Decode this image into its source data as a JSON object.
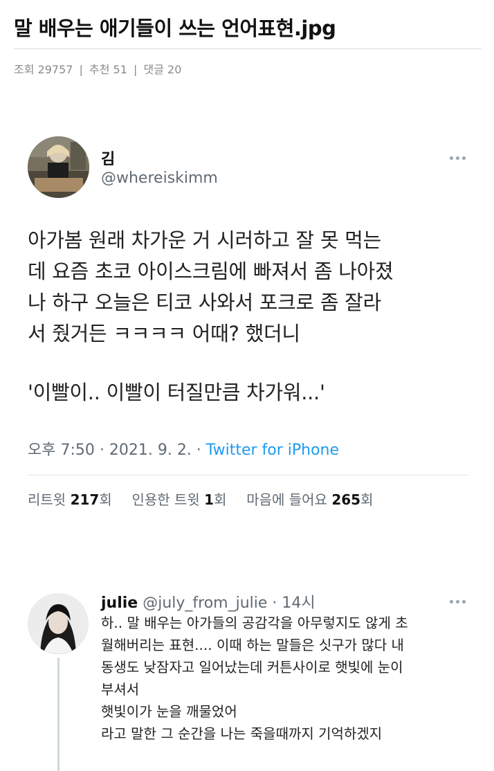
{
  "post": {
    "title": "말 배우는 애기들이 쓰는 언어표현.jpg",
    "views_label": "조회 29757",
    "recommend_label": "추천 51",
    "comments_label": "댓글 20",
    "separator": "|"
  },
  "tweet": {
    "name": "김",
    "handle": "@whereiskimm",
    "more_icon": "more-horizontal-icon",
    "body_lines": [
      "아가봄 원래 차가운 거 시러하고 잘 못 먹는",
      "데 요즘 초코 아이스크림에 빠져서 좀 나아졌",
      "나 하구 오늘은 티코 사와서 포크로 좀 잘라",
      "서 줬거든 ㅋㅋㅋㅋ 어때? 했더니"
    ],
    "quote": "'이빨이.. 이빨이 터질만큼 차가워...'",
    "time": "오후 7:50 · 2021. 9. 2. · ",
    "client": "Twitter for iPhone",
    "retweet_label": "리트윗 ",
    "retweet_count": "217",
    "retweet_unit": "회",
    "quote_label": "인용한 트윗 ",
    "quote_count": "1",
    "quote_unit": "회",
    "like_label": "마음에 들어요 ",
    "like_count": "265",
    "like_unit": "회"
  },
  "reply": {
    "name": "julie",
    "meta": " @july_from_julie · 14시",
    "more_icon": "more-horizontal-icon",
    "body_lines": [
      "하.. 말 배우는 아가들의 공감각을 아무렇지도 않게 초",
      "월해버리는 표현.... 이때 하는 말들은 싯구가 많다 내",
      "동생도 낮잠자고 일어났는데 커튼사이로 햇빛에 눈이",
      "부셔서",
      "햇빛이가 눈을 깨물었어",
      "라고 말한 그 순간을 나는 죽을때까지 기억하겠지"
    ]
  }
}
